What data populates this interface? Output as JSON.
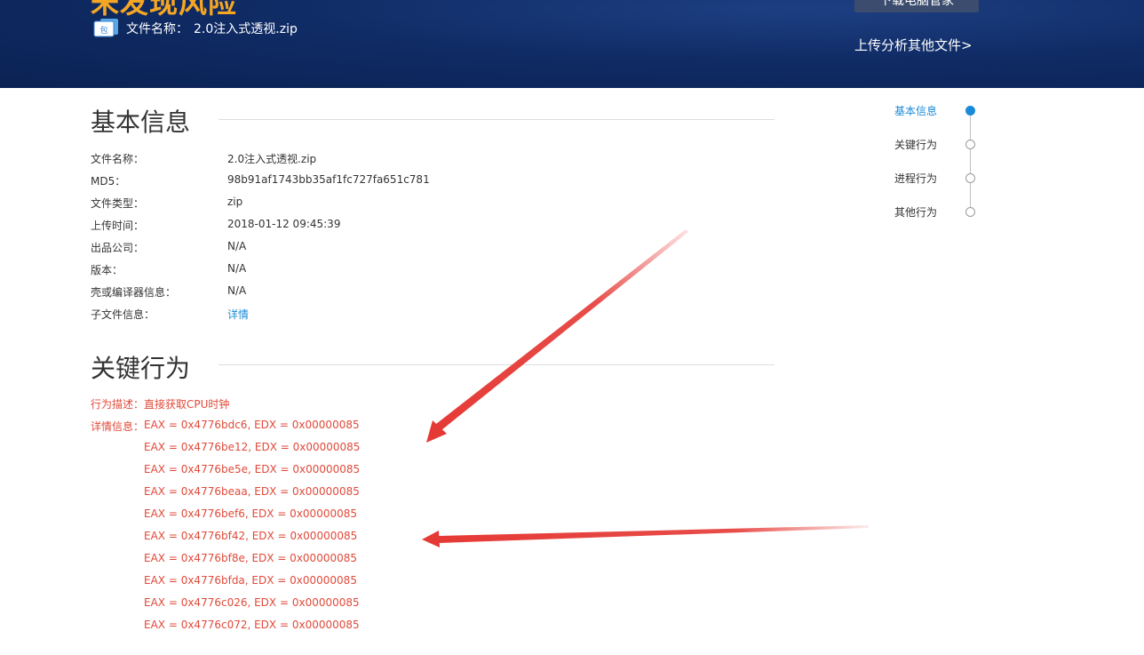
{
  "header": {
    "verdict_text": "未发现风险",
    "file_label": "文件名称：",
    "file_name": "2.0注入式透视.zip",
    "file_icon_text": "包",
    "download_button": "下载电脑管家",
    "upload_link": "上传分析其他文件>"
  },
  "basic_info": {
    "title": "基本信息",
    "rows": [
      {
        "label": "文件名称：",
        "value": "2.0注入式透视.zip"
      },
      {
        "label": "MD5：",
        "value": "98b91af1743bb35af1fc727fa651c781"
      },
      {
        "label": "文件类型：",
        "value": "zip"
      },
      {
        "label": "上传时间：",
        "value": "2018-01-12 09:45:39"
      },
      {
        "label": "出品公司：",
        "value": "N/A"
      },
      {
        "label": "版本：",
        "value": "N/A"
      },
      {
        "label": "壳或编译器信息：",
        "value": "N/A"
      },
      {
        "label": "子文件信息：",
        "value": "详情"
      }
    ]
  },
  "key_behavior": {
    "title": "关键行为",
    "desc_label": "行为描述：",
    "desc_value": "直接获取CPU时钟",
    "detail_label": "详情信息：",
    "details": [
      "EAX = 0x4776bdc6, EDX = 0x00000085",
      "EAX = 0x4776be12, EDX = 0x00000085",
      "EAX = 0x4776be5e, EDX = 0x00000085",
      "EAX = 0x4776beaa, EDX = 0x00000085",
      "EAX = 0x4776bef6, EDX = 0x00000085",
      "EAX = 0x4776bf42, EDX = 0x00000085",
      "EAX = 0x4776bf8e, EDX = 0x00000085",
      "EAX = 0x4776bfda, EDX = 0x00000085",
      "EAX = 0x4776c026, EDX = 0x00000085",
      "EAX = 0x4776c072, EDX = 0x00000085"
    ]
  },
  "side_nav": {
    "items": [
      {
        "label": "基本信息",
        "active": true
      },
      {
        "label": "关键行为",
        "active": false
      },
      {
        "label": "进程行为",
        "active": false
      },
      {
        "label": "其他行为",
        "active": false
      }
    ]
  },
  "colors": {
    "header_bg": "#0f2a63",
    "accent": "#1a8ad8",
    "behavior_red": "#e04a3a",
    "arrow_red": "#e53935"
  }
}
